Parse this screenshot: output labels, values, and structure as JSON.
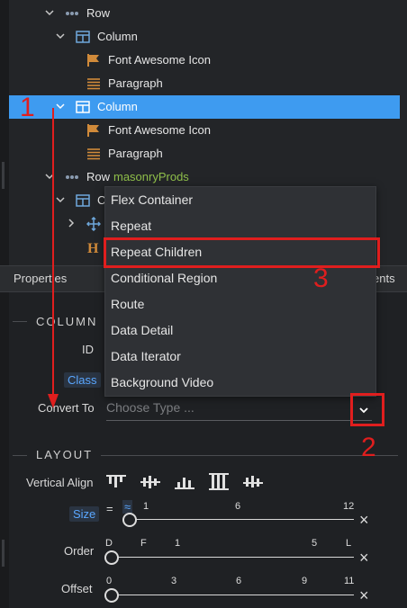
{
  "tree": {
    "items": [
      {
        "label": "Row",
        "label2": ""
      },
      {
        "label": "Column",
        "label2": ""
      },
      {
        "label": "Font Awesome Icon",
        "label2": ""
      },
      {
        "label": "Paragraph",
        "label2": ""
      },
      {
        "label": "Column",
        "label2": ""
      },
      {
        "label": "Font Awesome Icon",
        "label2": ""
      },
      {
        "label": "Paragraph",
        "label2": ""
      },
      {
        "label": "Row",
        "label2": "masonryProds"
      },
      {
        "label": "C",
        "label2": ""
      }
    ]
  },
  "props_bar": {
    "left": "Properties",
    "right": "ents"
  },
  "column_section": {
    "title": "COLUMN",
    "id_label": "ID",
    "class_label": "Class",
    "convert_label": "Convert To",
    "convert_placeholder": "Choose Type ..."
  },
  "dropdown": {
    "options": [
      "Flex Container",
      "Repeat",
      "Repeat Children",
      "Conditional Region",
      "Route",
      "Data Detail",
      "Data Iterator",
      "Background Video"
    ]
  },
  "layout_section": {
    "title": "LAYOUT",
    "vertical_align_label": "Vertical Align",
    "size_label": "Size",
    "size_eq": "=",
    "size_approx": "≈",
    "size_ticks": [
      "1",
      "6",
      "12"
    ],
    "order_label": "Order",
    "order_ticks": [
      "D",
      "F",
      "1",
      "5",
      "L"
    ],
    "offset_label": "Offset",
    "offset_ticks": [
      "0",
      "3",
      "6",
      "9",
      "11"
    ],
    "clear_symbol": "×"
  },
  "annotations": {
    "step1": "1",
    "step2": "2",
    "step3": "3"
  },
  "colors": {
    "selection": "#3e9bf0",
    "accent_blue": "#5aa7ff",
    "annotation_red": "#e01e1e"
  }
}
